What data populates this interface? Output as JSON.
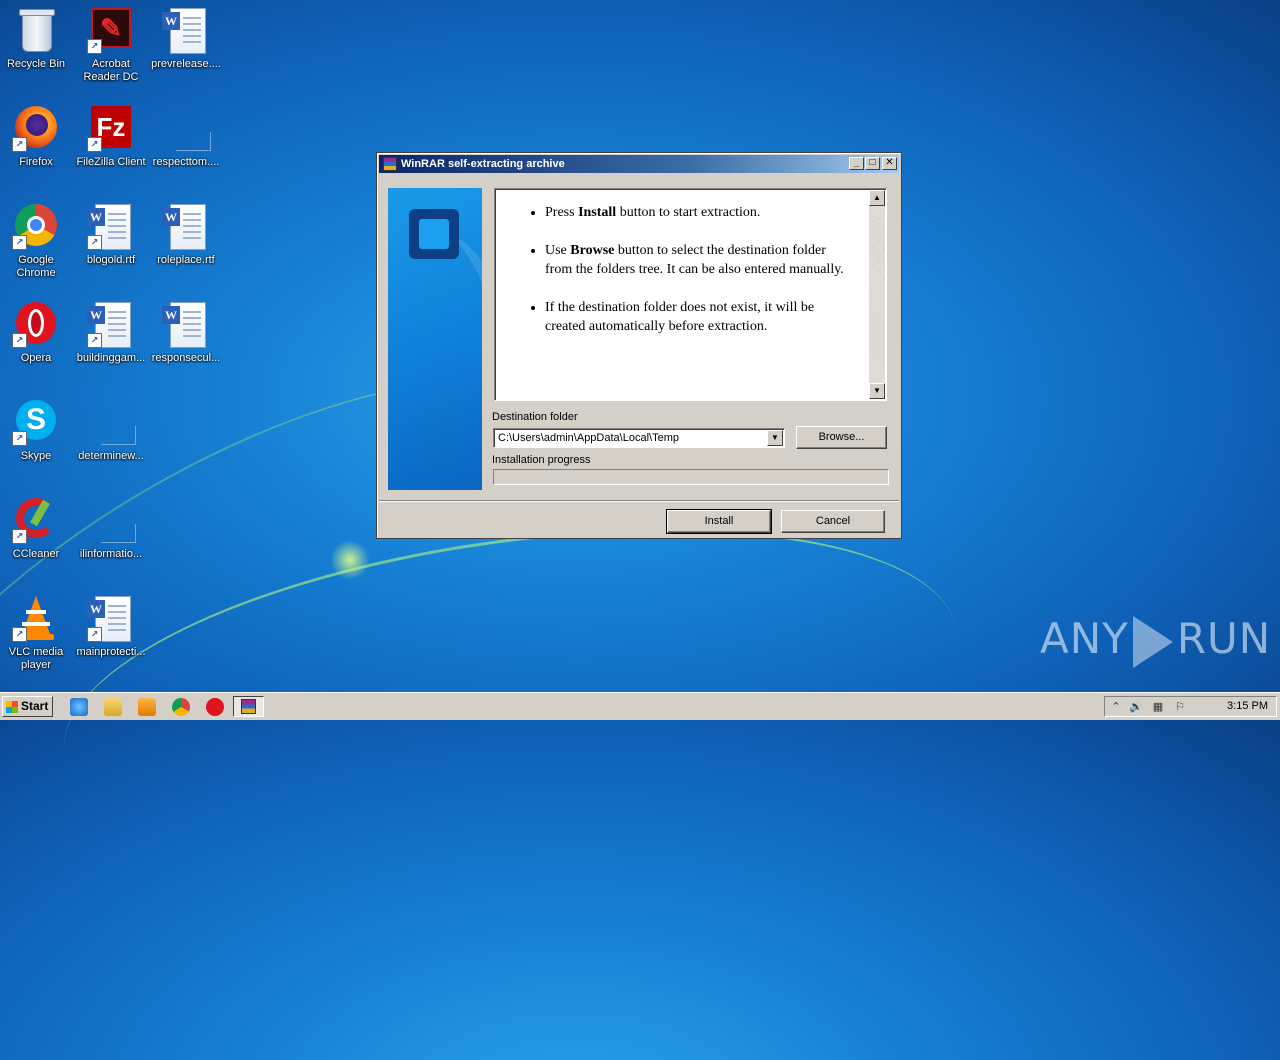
{
  "desktop": {
    "icons": [
      {
        "label": "Recycle Bin",
        "icon": "recycle-bin-icon"
      },
      {
        "label": "Acrobat Reader DC",
        "icon": "acrobat-icon"
      },
      {
        "label": "prevrelease....",
        "icon": "word-document-icon"
      },
      {
        "label": "Firefox",
        "icon": "firefox-icon"
      },
      {
        "label": "FileZilla Client",
        "icon": "filezilla-icon"
      },
      {
        "label": "respecttom....",
        "icon": "blank-file-icon"
      },
      {
        "label": "Google Chrome",
        "icon": "chrome-icon"
      },
      {
        "label": "blogold.rtf",
        "icon": "word-document-icon"
      },
      {
        "label": "roleplace.rtf",
        "icon": "word-document-icon"
      },
      {
        "label": "Opera",
        "icon": "opera-icon"
      },
      {
        "label": "buildinggam...",
        "icon": "word-document-icon"
      },
      {
        "label": "responsecul...",
        "icon": "word-document-icon"
      },
      {
        "label": "Skype",
        "icon": "skype-icon"
      },
      {
        "label": "determinew...",
        "icon": "blank-file-icon"
      },
      {
        "label": "CCleaner",
        "icon": "ccleaner-icon"
      },
      {
        "label": "ilinformatio...",
        "icon": "blank-file-icon"
      },
      {
        "label": "VLC media player",
        "icon": "vlc-icon"
      },
      {
        "label": "mainprotecti...",
        "icon": "word-document-icon"
      }
    ]
  },
  "dialog": {
    "title": "WinRAR self-extracting archive",
    "instructions": {
      "item1_pre": "Press ",
      "item1_bold": "Install",
      "item1_post": " button to start extraction.",
      "item2_pre": "Use ",
      "item2_bold": "Browse",
      "item2_post": " button to select the destination folder from the folders tree. It can be also entered manually.",
      "item3": "If the destination folder does not exist, it will be created automatically before extraction."
    },
    "destination_label": "Destination folder",
    "destination_value": "C:\\Users\\admin\\AppData\\Local\\Temp",
    "browse_label": "Browse...",
    "progress_label": "Installation progress",
    "progress_value": 0,
    "install_label": "Install",
    "cancel_label": "Cancel"
  },
  "taskbar": {
    "start_label": "Start",
    "clock": "3:15 PM"
  },
  "watermark": {
    "left": "ANY",
    "right": "RUN"
  }
}
